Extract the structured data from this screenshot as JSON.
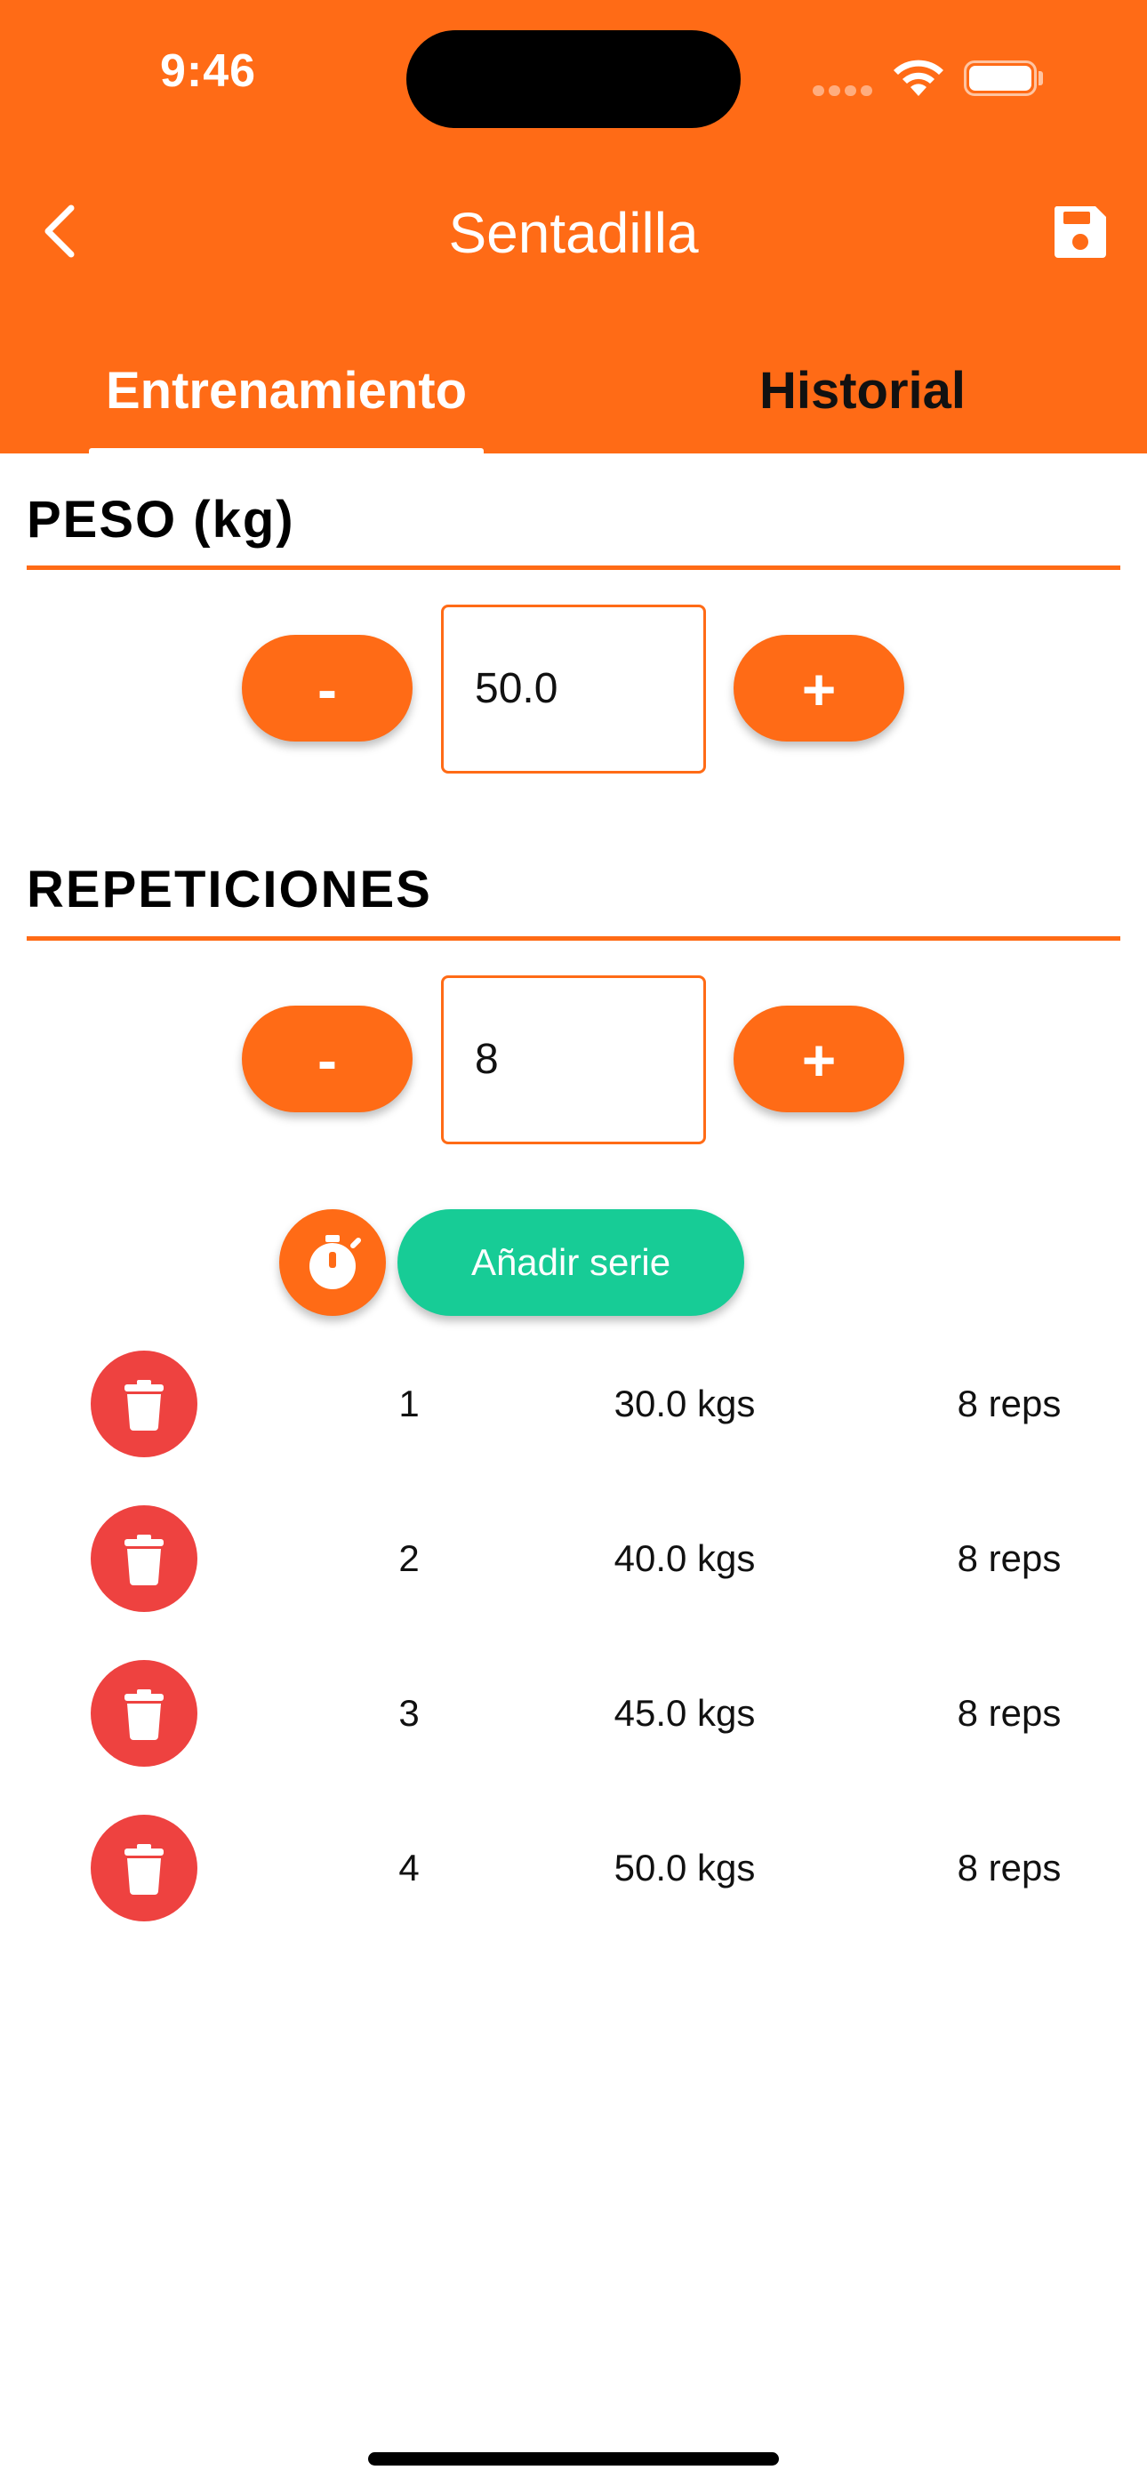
{
  "status_bar": {
    "time": "9:46"
  },
  "header": {
    "title": "Sentadilla",
    "tabs": [
      {
        "label": "Entrenamiento",
        "active": true
      },
      {
        "label": "Historial",
        "active": false
      }
    ]
  },
  "peso": {
    "title": "PESO (kg)",
    "minus_label": "-",
    "plus_label": "+",
    "value": "50.0"
  },
  "repeticiones": {
    "title": "REPETICIONES",
    "minus_label": "-",
    "plus_label": "+",
    "value": "8"
  },
  "actions": {
    "add_set_label": "Añadir serie"
  },
  "sets": [
    {
      "num": "1",
      "weight": "30.0 kgs",
      "reps": "8 reps"
    },
    {
      "num": "2",
      "weight": "40.0 kgs",
      "reps": "8 reps"
    },
    {
      "num": "3",
      "weight": "45.0 kgs",
      "reps": "8 reps"
    },
    {
      "num": "4",
      "weight": "50.0 kgs",
      "reps": "8 reps"
    }
  ],
  "colors": {
    "accent": "#FF6B16",
    "add_button": "#17CC96",
    "delete_button": "#EE4240"
  },
  "icons": {
    "back": "chevron-left-icon",
    "save": "floppy-disk-icon",
    "timer": "stopwatch-icon",
    "delete": "trash-icon"
  }
}
